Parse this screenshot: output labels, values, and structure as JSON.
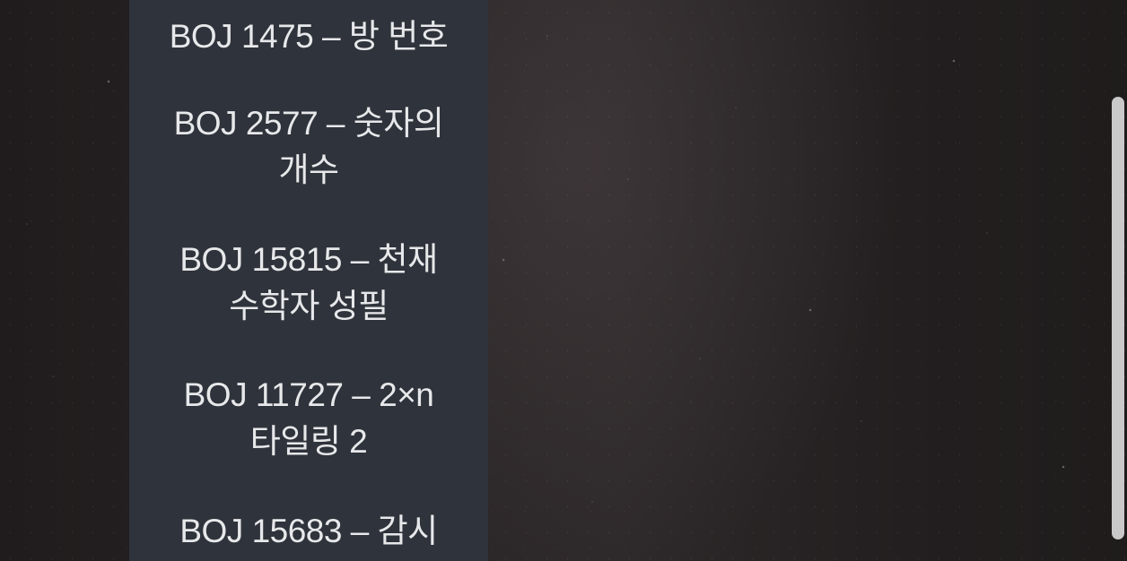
{
  "sidebar": {
    "items": [
      {
        "label": "BOJ 1475 – 방 번호"
      },
      {
        "label": "BOJ 2577 – 숫자의 개수"
      },
      {
        "label": "BOJ 15815 – 천재 수학자 성필"
      },
      {
        "label": "BOJ 11727 – 2×n 타일링 2"
      },
      {
        "label": "BOJ 15683 – 감시"
      }
    ]
  },
  "colors": {
    "panel": "#2f333b",
    "text": "#e7e8ea",
    "scrollbar": "#c9c9c9"
  }
}
